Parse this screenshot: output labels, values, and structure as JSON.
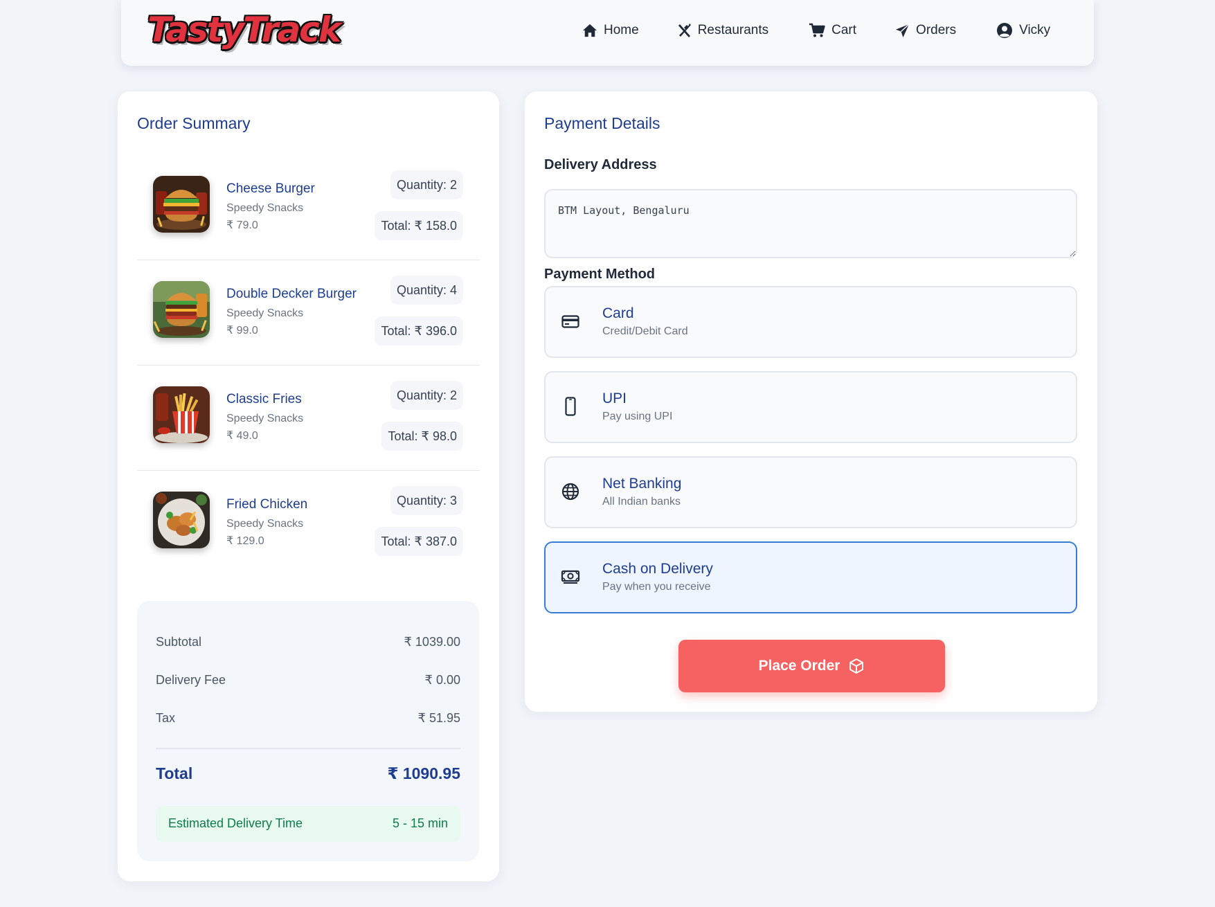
{
  "header": {
    "logo_text": "TastyTrack",
    "nav": [
      {
        "label": "Home",
        "icon": "home-icon"
      },
      {
        "label": "Restaurants",
        "icon": "utensils-icon"
      },
      {
        "label": "Cart",
        "icon": "cart-icon"
      },
      {
        "label": "Orders",
        "icon": "paper-plane-icon"
      },
      {
        "label": "Vicky",
        "icon": "user-circle-icon"
      }
    ]
  },
  "order_summary": {
    "title": "Order Summary",
    "items": [
      {
        "name": "Cheese Burger",
        "restaurant": "Speedy Snacks",
        "price": "₹ 79.0",
        "quantity": "Quantity: 2",
        "total": "Total: ₹ 158.0",
        "image": "cheese-burger-image"
      },
      {
        "name": "Double Decker Burger",
        "restaurant": "Speedy Snacks",
        "price": "₹ 99.0",
        "quantity": "Quantity: 4",
        "total": "Total: ₹ 396.0",
        "image": "double-decker-burger-image"
      },
      {
        "name": "Classic Fries",
        "restaurant": "Speedy Snacks",
        "price": "₹ 49.0",
        "quantity": "Quantity: 2",
        "total": "Total: ₹ 98.0",
        "image": "classic-fries-image"
      },
      {
        "name": "Fried Chicken",
        "restaurant": "Speedy Snacks",
        "price": "₹ 129.0",
        "quantity": "Quantity: 3",
        "total": "Total: ₹ 387.0",
        "image": "fried-chicken-image"
      }
    ],
    "subtotal_label": "Subtotal",
    "subtotal_value": "₹ 1039.00",
    "delivery_fee_label": "Delivery Fee",
    "delivery_fee_value": "₹ 0.00",
    "tax_label": "Tax",
    "tax_value": "₹ 51.95",
    "total_label": "Total",
    "total_value": "₹ 1090.95",
    "eta_label": "Estimated Delivery Time",
    "eta_value": "5 - 15 min"
  },
  "payment": {
    "title": "Payment Details",
    "address_label": "Delivery Address",
    "address_value": "BTM Layout, Bengaluru",
    "method_label": "Payment Method",
    "methods": [
      {
        "title": "Card",
        "subtitle": "Credit/Debit Card",
        "icon": "credit-card-icon",
        "selected": false
      },
      {
        "title": "UPI",
        "subtitle": "Pay using UPI",
        "icon": "mobile-phone-icon",
        "selected": false
      },
      {
        "title": "Net Banking",
        "subtitle": "All Indian banks",
        "icon": "globe-icon",
        "selected": false
      },
      {
        "title": "Cash on Delivery",
        "subtitle": "Pay when you receive",
        "icon": "money-bill-icon",
        "selected": true
      }
    ],
    "place_order_label": "Place Order",
    "place_order_icon": "cube-icon"
  },
  "colors": {
    "background": "#f1f4f9",
    "heading_blue": "#1f3d8f",
    "accent_red": "#f66161",
    "selected_border": "#3a7bd5",
    "eta_green": "#0f7a4c"
  }
}
